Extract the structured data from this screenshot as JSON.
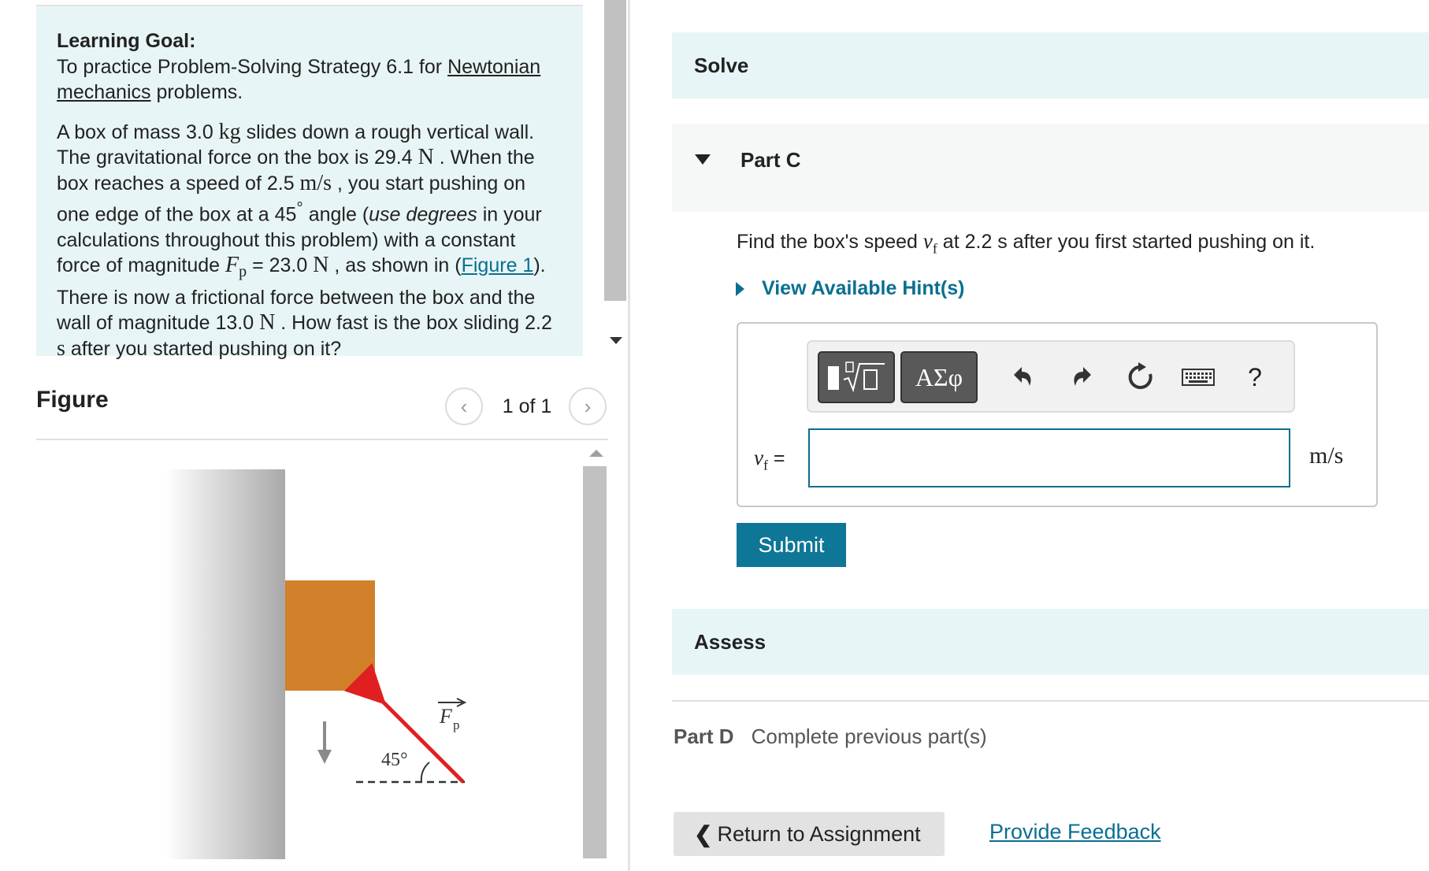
{
  "learning_goal": {
    "title": "Learning Goal:",
    "intro": "To practice Problem-Solving Strategy 6.1 for ",
    "link": "Newtonian mechanics",
    "outro": " problems."
  },
  "problem": {
    "t1": "A box of mass 3.0 ",
    "u_kg": "kg",
    "t2": " slides down a rough vertical wall. The gravitational force on the box is 29.4 ",
    "u_N": "N",
    "t3": " .  When the box reaches a speed of 2.5 ",
    "u_ms": "m/s",
    "t4": " , you start pushing on one edge of the box at a 45",
    "deg": "°",
    "t5": " angle (",
    "emph": "use degrees",
    "t6": " in your calculations throughout this problem) with a constant force of magnitude ",
    "fp_sym": "F",
    "fp_sub": "p",
    "t7": " = 23.0 ",
    "t8": " , as shown in (",
    "fig_link": "Figure 1",
    "t9": "). There is now a frictional force between the box and the wall of magnitude 13.0 ",
    "t10": " . How fast is the box sliding 2.2 ",
    "u_s": "s",
    "t11": " after you started pushing on it?"
  },
  "figure": {
    "title": "Figure",
    "pager": "1 of 1",
    "prev_icon": "chevron-left-icon",
    "next_icon": "chevron-right-icon",
    "angle_label": "45°",
    "force_label": "F",
    "force_sub": "p",
    "colors": {
      "box": "#d2802a",
      "force": "#e02020"
    }
  },
  "solve": {
    "label": "Solve"
  },
  "part_c": {
    "title": "Part C",
    "q1": "Find the box's speed ",
    "var": "v",
    "var_sub": "f",
    "q2": " at 2.2 s after you first started pushing on it.",
    "hint": "View Available Hint(s)",
    "toolbar": {
      "greek": "ΑΣφ",
      "help": "?",
      "icons": [
        "templates-icon",
        "undo-icon",
        "redo-icon",
        "reset-icon",
        "keyboard-icon",
        "help-icon"
      ]
    },
    "answer_var": "v",
    "answer_var_sub": "f",
    "equals": " =",
    "answer_value": "",
    "unit": "m/s",
    "submit": "Submit"
  },
  "assess": {
    "label": "Assess"
  },
  "part_d": {
    "label": "Part D",
    "status": "Complete previous part(s)"
  },
  "footer": {
    "return_label": "Return to Assignment",
    "feedback_label": "Provide Feedback"
  },
  "colors": {
    "accent": "#0e7696",
    "band": "#e8f5f6"
  }
}
